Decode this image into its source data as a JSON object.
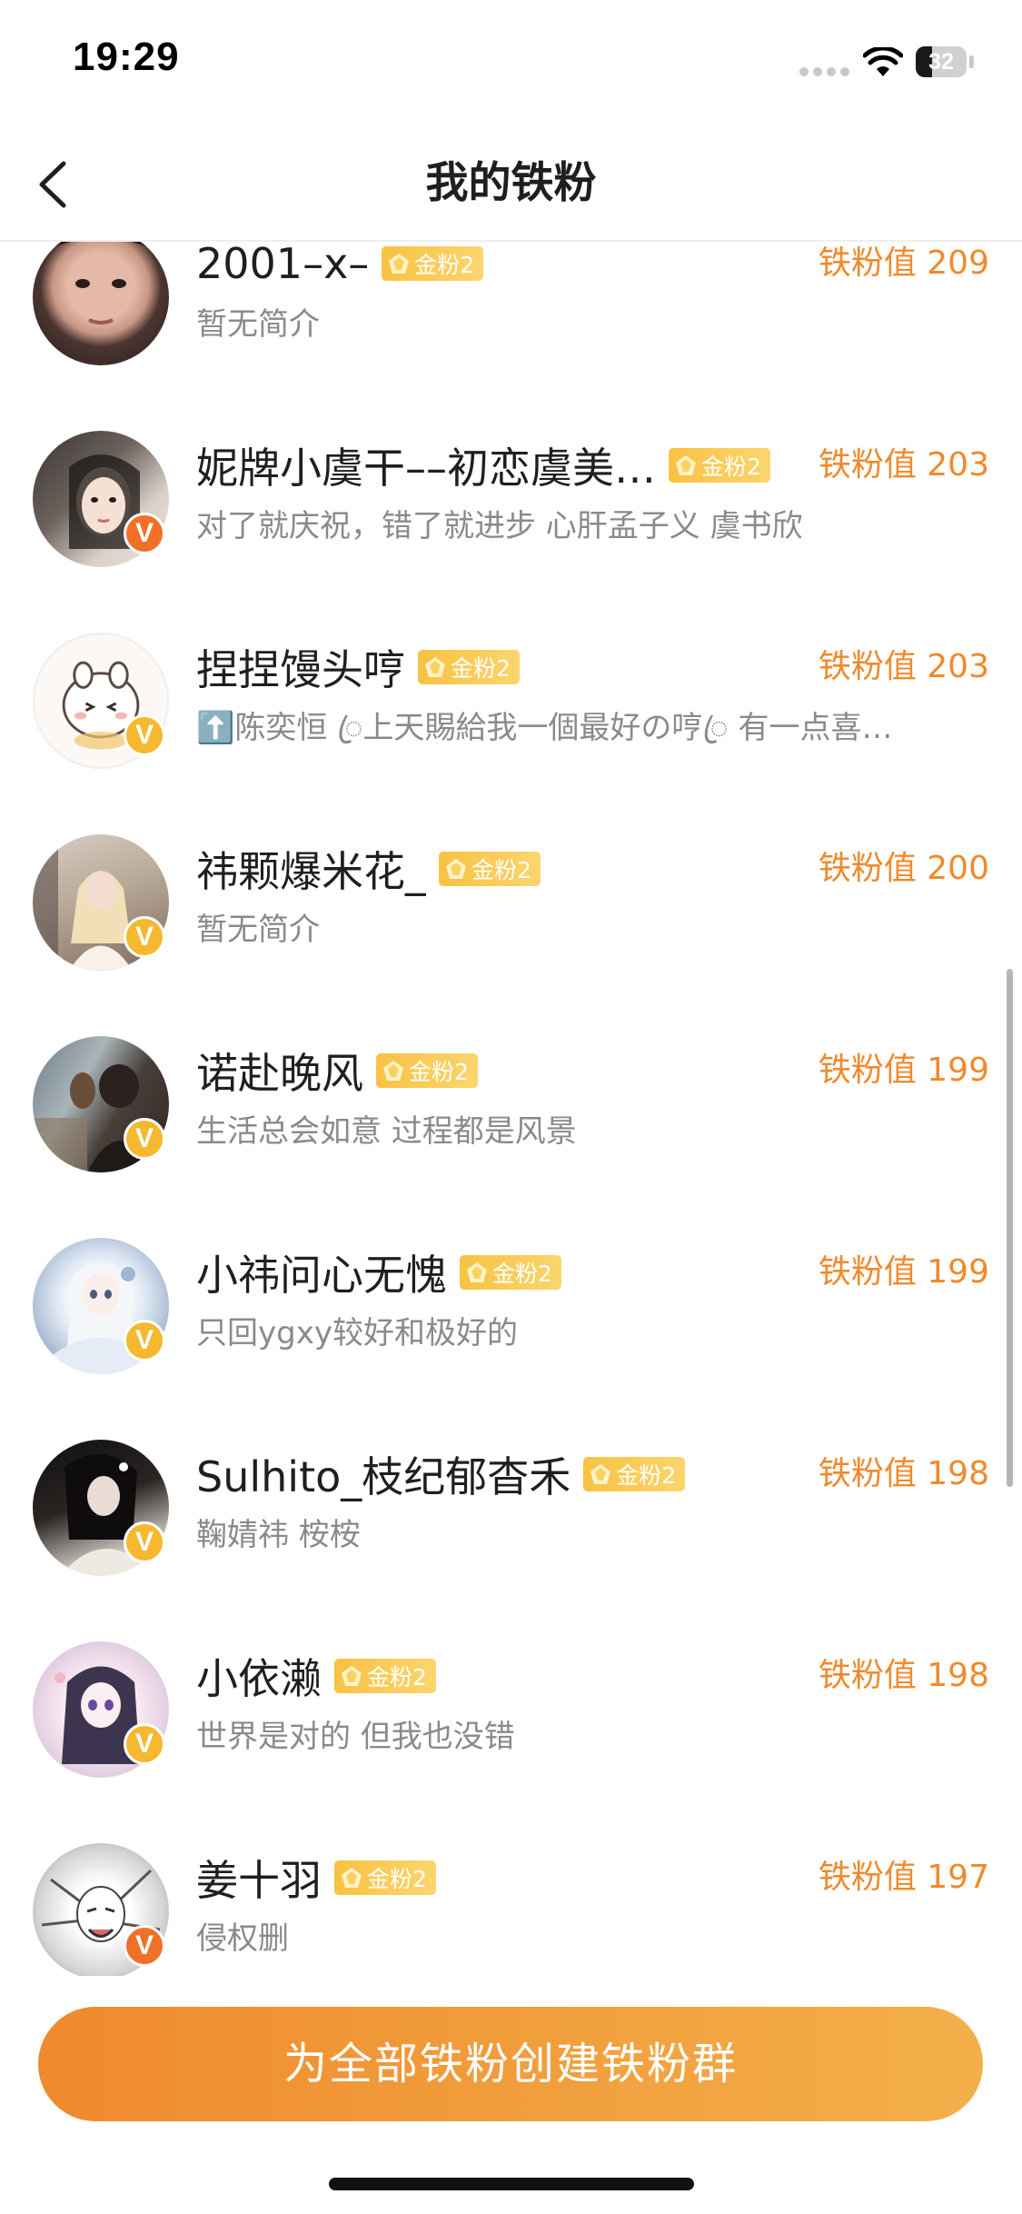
{
  "status_bar": {
    "time": "19:29",
    "battery": "32",
    "battery_level": 0.32
  },
  "nav": {
    "title": "我的铁粉",
    "back_icon": "chevron-left-icon"
  },
  "fans": [
    {
      "name": "2001–x–",
      "level": "金粉2",
      "value": "铁粉值 209",
      "bio": "暂无简介",
      "verified": "none"
    },
    {
      "name": "妮牌小虞干––初恋虞美…",
      "level": "金粉2",
      "value": "铁粉值 203",
      "bio": "对了就庆祝，错了就进步 心肝孟子义 虞书欣",
      "verified": "orange"
    },
    {
      "name": "捏捏馒头哼",
      "level": "金粉2",
      "value": "铁粉值 203",
      "bio": "⬆️陈奕恒 ꦿ上天賜給我一個最好の哼ꦿ 有一点喜…",
      "verified": "yellow"
    },
    {
      "name": "祎颗爆米花_",
      "level": "金粉2",
      "value": "铁粉值 200",
      "bio": "暂无简介",
      "verified": "yellow"
    },
    {
      "name": "诺赴晚风",
      "level": "金粉2",
      "value": "铁粉值 199",
      "bio": "生活总会如意 过程都是风景",
      "verified": "yellow"
    },
    {
      "name": "小祎问心无愧",
      "level": "金粉2",
      "value": "铁粉值 199",
      "bio": "只回ygxy较好和极好的",
      "verified": "yellow"
    },
    {
      "name": "Sulhito_枝纪郁杳禾",
      "level": "金粉2",
      "value": "铁粉值 198",
      "bio": "鞠婧祎 桉桉",
      "verified": "yellow"
    },
    {
      "name": "小依濑",
      "level": "金粉2",
      "value": "铁粉值 198",
      "bio": "世界是对的 但我也没错",
      "verified": "yellow"
    },
    {
      "name": "姜十羽",
      "level": "金粉2",
      "value": "铁粉值 197",
      "bio": "侵权删",
      "verified": "orange"
    }
  ],
  "verified_badge_text": "V",
  "bottom": {
    "create_button_label": "为全部铁粉创建铁粉群"
  },
  "colors": {
    "accent": "#f08a2c",
    "level_badge": "#f8c243",
    "verified_orange": "#f0702a",
    "verified_yellow": "#f5b82e",
    "button_gradient_start": "#ef8a2e",
    "button_gradient_end": "#f3b04a"
  }
}
